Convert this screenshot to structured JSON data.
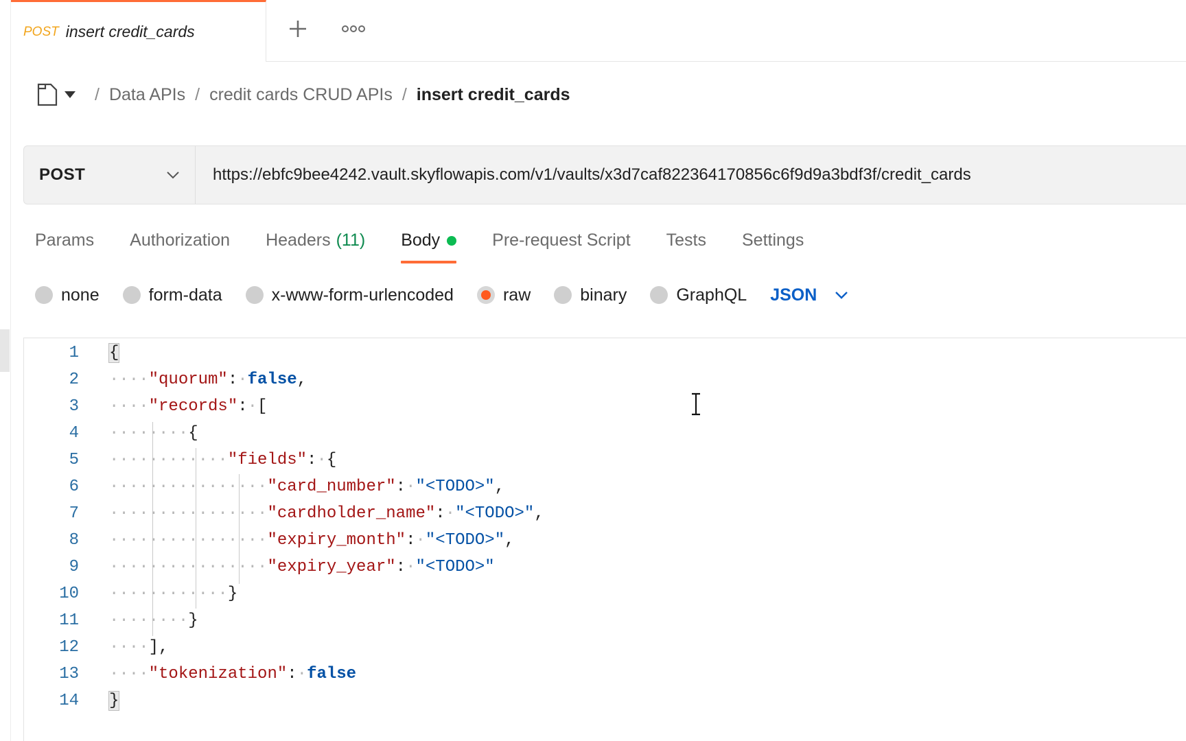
{
  "tab": {
    "method": "POST",
    "title": "insert credit_cards"
  },
  "breadcrumb": {
    "items": [
      "Data APIs",
      "credit cards CRUD APIs"
    ],
    "current": "insert credit_cards"
  },
  "request": {
    "method": "POST",
    "url": "https://ebfc9bee4242.vault.skyflowapis.com/v1/vaults/x3d7caf822364170856c6f9d9a3bdf3f/credit_cards"
  },
  "request_tabs": {
    "params": "Params",
    "authorization": "Authorization",
    "headers": "Headers",
    "headers_count": "(11)",
    "body": "Body",
    "prerequest": "Pre-request Script",
    "tests": "Tests",
    "settings": "Settings"
  },
  "body_types": {
    "none": "none",
    "form_data": "form-data",
    "urlencoded": "x-www-form-urlencoded",
    "raw": "raw",
    "binary": "binary",
    "graphql": "GraphQL",
    "selected": "raw",
    "language": "JSON"
  },
  "editor": {
    "line_numbers": [
      "1",
      "2",
      "3",
      "4",
      "5",
      "6",
      "7",
      "8",
      "9",
      "10",
      "11",
      "12",
      "13",
      "14"
    ],
    "keys": {
      "quorum": "\"quorum\"",
      "records": "\"records\"",
      "fields": "\"fields\"",
      "card_number": "\"card_number\"",
      "cardholder_name": "\"cardholder_name\"",
      "expiry_month": "\"expiry_month\"",
      "expiry_year": "\"expiry_year\"",
      "tokenization": "\"tokenization\""
    },
    "values": {
      "quorum": "false",
      "todo": "\"<TODO>\"",
      "tokenization": "false"
    }
  },
  "colors": {
    "accent": "#ff6c37",
    "body_dot": "#0cbb52",
    "headers_count": "#0e8a4f",
    "json_link": "#0b5fc7",
    "json_key": "#a31515",
    "json_value": "#0451a5"
  }
}
